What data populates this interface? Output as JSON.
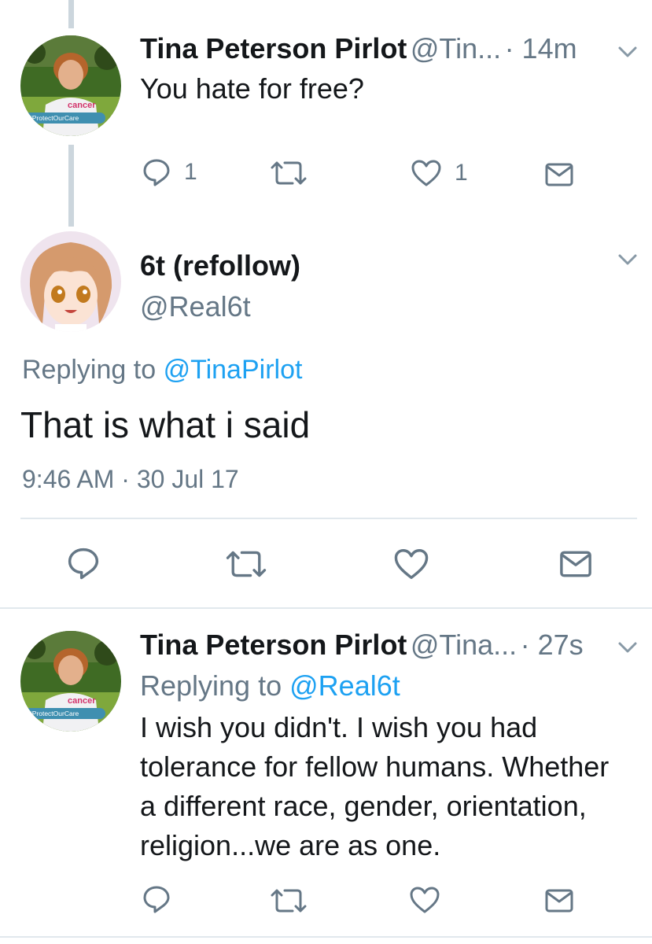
{
  "tweet1": {
    "name": "Tina Peterson Pirlot",
    "handle": "@Tin...",
    "time": "· 14m",
    "text": "You hate for free?",
    "reply_count": "1",
    "like_count": "1",
    "avatar_shirt_text": "cancer",
    "avatar_banner": "#ProtectOurCare"
  },
  "main": {
    "name": "6t (refollow)",
    "handle": "@Real6t",
    "replying_prefix": "Replying to",
    "replying_handle": "@TinaPirlot",
    "text": "That is what i said",
    "timestamp": "9:46 AM · 30 Jul 17"
  },
  "tweet3": {
    "name": "Tina Peterson Pirlot",
    "handle": "@Tina...",
    "time": "· 27s",
    "replying_prefix": "Replying to",
    "replying_handle": "@Real6t",
    "text_lines": [
      "I wish you didn't. I wish you had",
      "tolerance for fellow humans. Whether",
      "a different race, gender, orientation,",
      "religion...we are as one."
    ],
    "avatar_shirt_text": "cancer",
    "avatar_banner": "#ProtectOurCare"
  },
  "colors": {
    "accent": "#1da1f2",
    "muted": "#657786",
    "text": "#14171a",
    "divider": "#e1e8ed",
    "thread_line": "#ccd6dd"
  },
  "icons": [
    "reply-icon",
    "retweet-icon",
    "like-icon",
    "dm-icon",
    "chevron-down-icon"
  ]
}
